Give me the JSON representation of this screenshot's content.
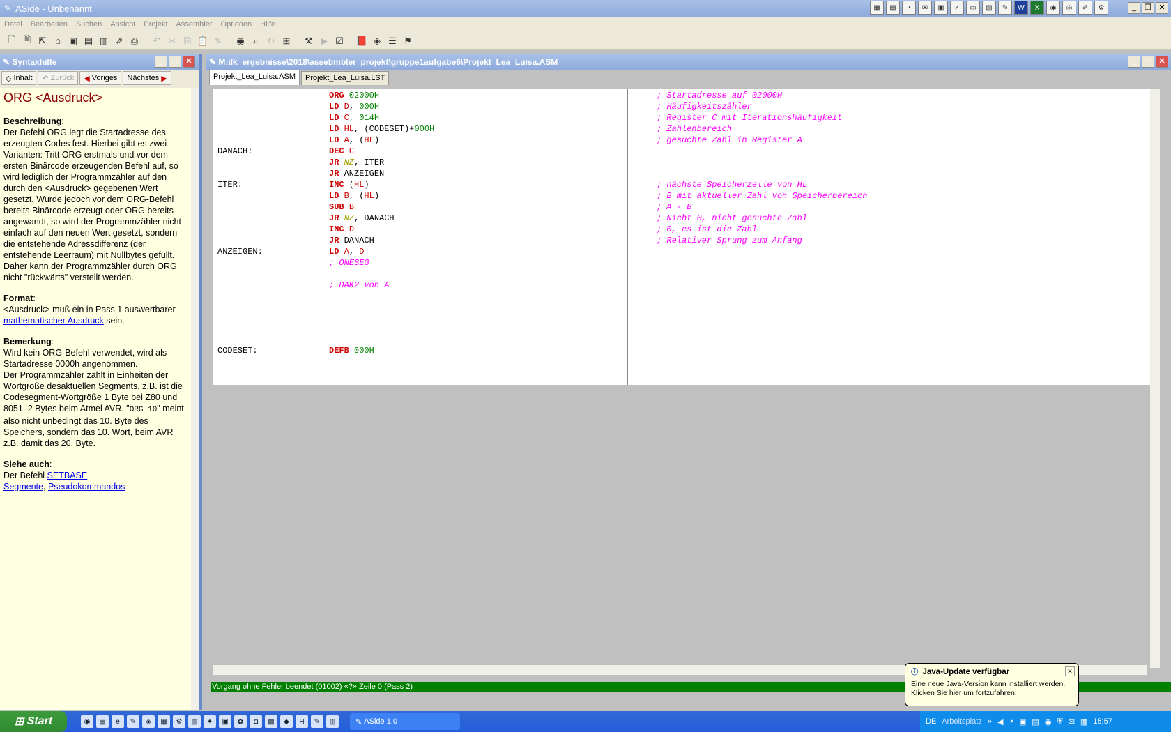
{
  "app": {
    "title": "ASide - Unbenannt"
  },
  "menu": [
    "Datei",
    "Bearbeiten",
    "Suchen",
    "Ansicht",
    "Projekt",
    "Assembler",
    "Optionen",
    "Hilfe"
  ],
  "help": {
    "title": "Syntaxhilfe",
    "nav": {
      "contents": "Inhalt",
      "back": "Zurück",
      "prev": "Voriges",
      "next": "Nächstes"
    },
    "heading": "ORG <Ausdruck>",
    "desc_label": "Beschreibung",
    "desc": "Der Befehl ORG legt die Startadresse des erzeugten Codes fest. Hierbei gibt es zwei Varianten: Tritt ORG erstmals und vor dem ersten Binärcode erzeugenden Befehl auf, so wird lediglich der Programmzähler auf den durch den <Ausdruck> gegebenen Wert gesetzt. Wurde jedoch vor dem ORG-Befehl bereits Binärcode erzeugt oder ORG bereits angewandt, so wird der Programmzähler nicht einfach auf den neuen Wert gesetzt, sondern die entstehende Adressdifferenz (der entstehende Leerraum) mit Nullbytes gefüllt. Daher kann der Programmzähler durch ORG nicht \"rückwärts\" verstellt werden.",
    "format_label": "Format",
    "format_pre": "<Ausdruck> muß ein in Pass 1 auswertbarer",
    "format_link": "mathematischer Ausdruck",
    "format_post": "sein.",
    "remark_label": "Bemerkung",
    "remark1": "Wird kein ORG-Befehl verwendet, wird als Startadresse 0000h angenommen.",
    "remark2_pre": "Der Programmzähler zählt in Einheiten der Wortgröße desaktuellen Segments, z.B. ist die Codesegment-Wortgröße 1 Byte bei Z80 und 8051, 2 Bytes beim Atmel AVR. \"",
    "remark2_code": "ORG 10",
    "remark2_post": "\" meint also nicht unbedingt das 10. Byte des Speichers, sondern das 10. Wort, beim AVR z.B. damit das 20. Byte.",
    "see_label": "Siehe auch",
    "see_pre": "Der Befehl",
    "see_links": [
      "SETBASE",
      "Segmente",
      "Pseudokommandos"
    ]
  },
  "editor": {
    "path": "M:\\lk_ergebnisse\\2018\\assebmbler_projekt\\gruppe1aufgabe6\\Projekt_Lea_Luisa.ASM",
    "tabs": [
      "Projekt_Lea_Luisa.ASM",
      "Projekt_Lea_Luisa.LST"
    ],
    "labels": [
      "DANACH:",
      "ITER:",
      "ANZEIGEN:",
      "CODESET:"
    ],
    "comments": [
      "; Startadresse auf 02000H",
      "; Häufigkeitszähler",
      "; Register C mit Iterationshäufigkeit",
      "; Zahlenbereich",
      "; gesuchte Zahl in Register A",
      "; nächste Speicherzelle von HL",
      "; B mit aktueller Zahl von Speicherbereich",
      "; A - B",
      "; Nicht 0, nicht gesuchte Zahl",
      "; 0, es ist die Zahl",
      "; Relativer Sprung zum Anfang",
      "; ONESEG",
      "; DAK2 von A"
    ]
  },
  "status": "Vorgang ohne Fehler beendet (01002) «?» Zeile 0 (Pass 2)",
  "taskbar": {
    "start": "Start",
    "task": "ASide 1.0",
    "lang": "DE",
    "workspace": "Arbeitsplatz",
    "time": "15:57"
  },
  "balloon": {
    "title": "Java-Update verfügbar",
    "text": "Eine neue Java-Version kann installiert werden. Klicken Sie hier um fortzufahren."
  }
}
